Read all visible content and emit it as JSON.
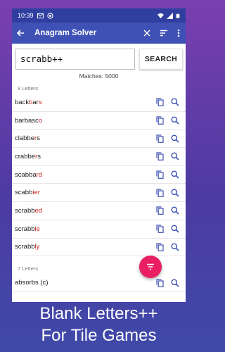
{
  "statusbar": {
    "time": "10:39"
  },
  "appbar": {
    "title": "Anagram Solver"
  },
  "search": {
    "value": "scrabb++",
    "button_label": "SEARCH"
  },
  "matches_text": "Matches: 5000",
  "groups": [
    {
      "label": "8 Letters",
      "words": [
        {
          "pre": "back",
          "hl": "b",
          "mid": "ar",
          "hl2": "s",
          "post": ""
        },
        {
          "pre": "barbasc",
          "hl": "o",
          "mid": "",
          "hl2": "",
          "post": ""
        },
        {
          "pre": "clabbe",
          "hl": "r",
          "mid": "s",
          "hl2": "",
          "post": ""
        },
        {
          "pre": "crabbe",
          "hl": "r",
          "mid": "s",
          "hl2": "",
          "post": ""
        },
        {
          "pre": "scabba",
          "hl": "rd",
          "mid": "",
          "hl2": "",
          "post": ""
        },
        {
          "pre": "scabb",
          "hl": "ier",
          "mid": "",
          "hl2": "",
          "post": ""
        },
        {
          "pre": "scrabb",
          "hl": "ed",
          "mid": "",
          "hl2": "",
          "post": ""
        },
        {
          "pre": "scrabb",
          "hl": "le",
          "mid": "",
          "hl2": "",
          "post": ""
        },
        {
          "pre": "scrabb",
          "hl": "ly",
          "mid": "",
          "hl2": "",
          "post": ""
        }
      ]
    },
    {
      "label": "7 Letters",
      "words": [
        {
          "pre": "absorbs (c)",
          "hl": "",
          "mid": "",
          "hl2": "",
          "post": ""
        }
      ]
    }
  ],
  "caption": {
    "line1": "Blank Letters++",
    "line2": "For Tile Games"
  },
  "colors": {
    "appbar": "#3f51b5",
    "statusbar": "#303f9f",
    "fab": "#e91e63",
    "highlight": "#c62828"
  }
}
